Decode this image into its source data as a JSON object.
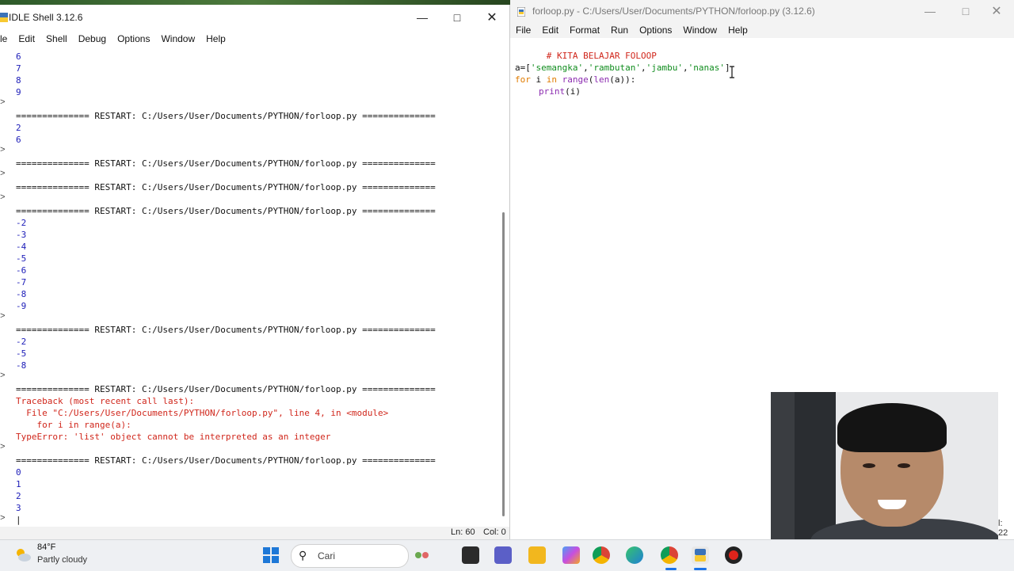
{
  "shell": {
    "title": "IDLE Shell 3.12.6",
    "menu": [
      "le",
      "Edit",
      "Shell",
      "Debug",
      "Options",
      "Window",
      "Help"
    ],
    "prompt_markers": [
      ">",
      ">",
      ">",
      ">",
      ">",
      ">",
      ">",
      ">"
    ],
    "lines": [
      {
        "text": "6",
        "kind": "out"
      },
      {
        "text": "7",
        "kind": "out"
      },
      {
        "text": "8",
        "kind": "out"
      },
      {
        "text": "9",
        "kind": "out"
      },
      {
        "text": "",
        "kind": "out"
      },
      {
        "text": "============== RESTART: C:/Users/User/Documents/PYTHON/forloop.py ==============",
        "kind": "restart"
      },
      {
        "text": "2",
        "kind": "out"
      },
      {
        "text": "6",
        "kind": "out"
      },
      {
        "text": "",
        "kind": "out"
      },
      {
        "text": "============== RESTART: C:/Users/User/Documents/PYTHON/forloop.py ==============",
        "kind": "restart"
      },
      {
        "text": "",
        "kind": "out"
      },
      {
        "text": "============== RESTART: C:/Users/User/Documents/PYTHON/forloop.py ==============",
        "kind": "restart"
      },
      {
        "text": "",
        "kind": "out"
      },
      {
        "text": "============== RESTART: C:/Users/User/Documents/PYTHON/forloop.py ==============",
        "kind": "restart"
      },
      {
        "text": "-2",
        "kind": "out"
      },
      {
        "text": "-3",
        "kind": "out"
      },
      {
        "text": "-4",
        "kind": "out"
      },
      {
        "text": "-5",
        "kind": "out"
      },
      {
        "text": "-6",
        "kind": "out"
      },
      {
        "text": "-7",
        "kind": "out"
      },
      {
        "text": "-8",
        "kind": "out"
      },
      {
        "text": "-9",
        "kind": "out"
      },
      {
        "text": "",
        "kind": "out"
      },
      {
        "text": "============== RESTART: C:/Users/User/Documents/PYTHON/forloop.py ==============",
        "kind": "restart"
      },
      {
        "text": "-2",
        "kind": "out"
      },
      {
        "text": "-5",
        "kind": "out"
      },
      {
        "text": "-8",
        "kind": "out"
      },
      {
        "text": "",
        "kind": "out"
      },
      {
        "text": "============== RESTART: C:/Users/User/Documents/PYTHON/forloop.py ==============",
        "kind": "restart"
      },
      {
        "text": "Traceback (most recent call last):",
        "kind": "err"
      },
      {
        "text": "  File \"C:/Users/User/Documents/PYTHON/forloop.py\", line 4, in <module>",
        "kind": "err"
      },
      {
        "text": "    for i in range(a):",
        "kind": "err"
      },
      {
        "text": "TypeError: 'list' object cannot be interpreted as an integer",
        "kind": "err"
      },
      {
        "text": "",
        "kind": "out"
      },
      {
        "text": "============== RESTART: C:/Users/User/Documents/PYTHON/forloop.py ==============",
        "kind": "restart"
      },
      {
        "text": "0",
        "kind": "out"
      },
      {
        "text": "1",
        "kind": "out"
      },
      {
        "text": "2",
        "kind": "out"
      },
      {
        "text": "3",
        "kind": "out"
      },
      {
        "text": "|",
        "kind": "restart"
      }
    ],
    "status": {
      "ln": "Ln: 60",
      "col": "Col: 0"
    }
  },
  "editor": {
    "title": "forloop.py - C:/Users/User/Documents/PYTHON/forloop.py (3.12.6)",
    "menu": [
      "File",
      "Edit",
      "Format",
      "Run",
      "Options",
      "Window",
      "Help"
    ],
    "code": {
      "comment": "# KITA BELAJAR FOLOOP",
      "line2_a": "a=[",
      "s1": "'semangka'",
      "s2": "'rambutan'",
      "s3": "'jambu'",
      "s4": "'nanas'",
      "comma": ",",
      "close": "]",
      "for_kw": "for",
      "for_i": " i ",
      "in_kw": "in",
      "range_fn": "range",
      "len_fn": "len",
      "rest": "(a)):",
      "open_paren": "(",
      "print_fn": "print",
      "print_arg": "(i)"
    },
    "status_edge": "l: 22"
  },
  "taskbar": {
    "weather_temp": "84°F",
    "weather_desc": "Partly cloudy",
    "search_placeholder": "Cari"
  }
}
